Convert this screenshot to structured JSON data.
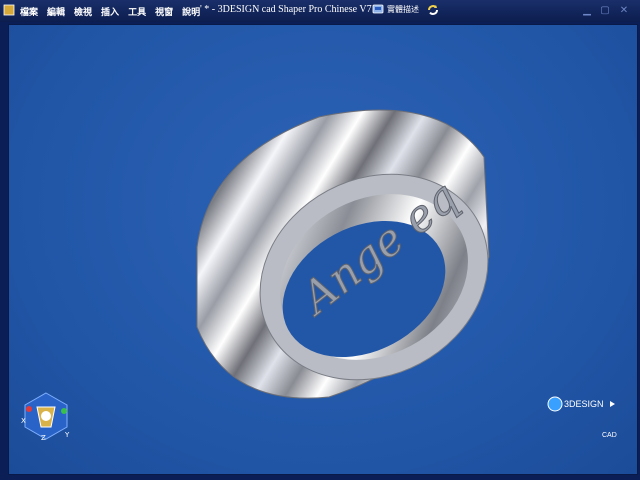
{
  "app": {
    "title": "' * -  3DESIGN cad Shaper Pro Chinese V7",
    "menu": [
      "檔案",
      "編輯",
      "檢視",
      "插入",
      "工具",
      "視窗",
      "說明"
    ],
    "toolbar_label": "實體描述"
  },
  "viewport": {
    "model_icon": "ring-3d-model",
    "engraving": "Ange eq"
  },
  "axis_widget": {
    "x": "X",
    "y": "Y",
    "z": "Z"
  },
  "brand": {
    "logo_text": "3DESIGN",
    "logo_sub": "CAD"
  },
  "icons": [
    "app-icon",
    "model-info-icon",
    "refresh-icon",
    "minimize-icon",
    "maximize-icon",
    "close-icon"
  ],
  "colors": {
    "background": "#2257a8",
    "titlebar": "#0c1d4e",
    "accent": "#3aa0ff"
  }
}
